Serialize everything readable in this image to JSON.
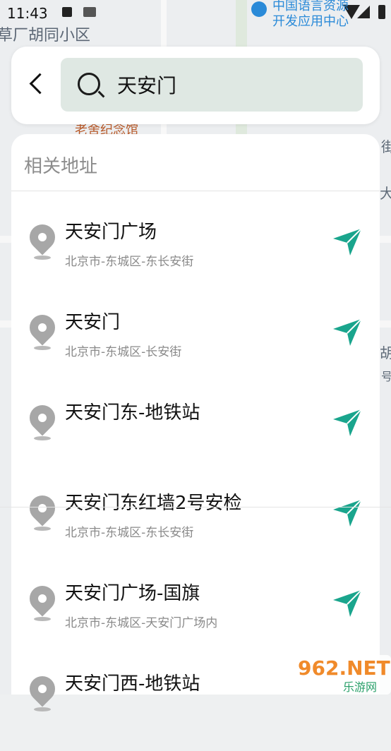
{
  "status_bar": {
    "time": "11:43",
    "brand_line1": "中国语言资源",
    "brand_line2": "开发应用中心"
  },
  "map_labels": [
    "草厂胡同小区",
    "老舍纪念馆",
    "街",
    "大",
    "胡",
    "号"
  ],
  "search": {
    "value": "天安门",
    "placeholder": "天安门"
  },
  "results": {
    "header": "相关地址",
    "items": [
      {
        "name": "天安门广场",
        "address": "北京市-东城区-东长安街"
      },
      {
        "name": "天安门",
        "address": "北京市-东城区-长安街"
      },
      {
        "name": "天安门东-地铁站",
        "address": ""
      },
      {
        "name": "天安门东红墙2号安检",
        "address": "北京市-东城区-东长安街"
      },
      {
        "name": "天安门广场-国旗",
        "address": "北京市-东城区-天安门广场内"
      },
      {
        "name": "天安门西-地铁站",
        "address": ""
      }
    ]
  },
  "watermark": {
    "line1": "962.NET",
    "line2": "乐游网"
  },
  "colors": {
    "accent": "#1aa58d",
    "search_bg": "#dfe8e3",
    "pin": "#a7a7a7"
  }
}
